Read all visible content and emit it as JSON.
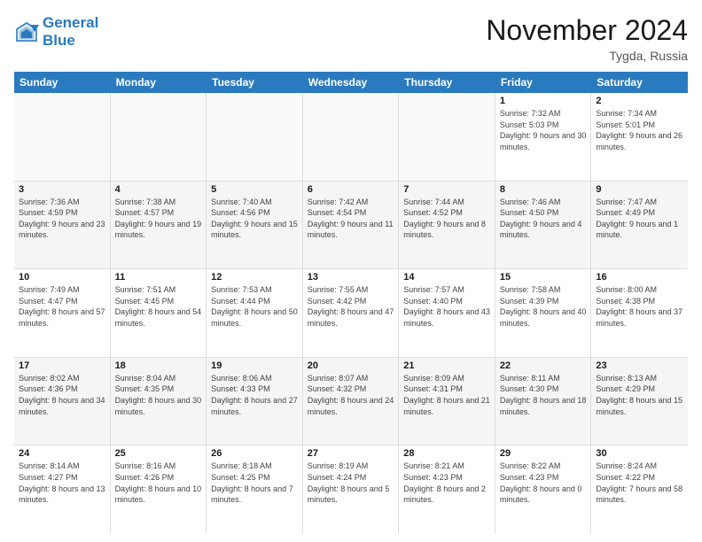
{
  "logo": {
    "line1": "General",
    "line2": "Blue"
  },
  "title": "November 2024",
  "location": "Tygda, Russia",
  "header_days": [
    "Sunday",
    "Monday",
    "Tuesday",
    "Wednesday",
    "Thursday",
    "Friday",
    "Saturday"
  ],
  "weeks": [
    [
      {
        "day": "",
        "info": "",
        "empty": true
      },
      {
        "day": "",
        "info": "",
        "empty": true
      },
      {
        "day": "",
        "info": "",
        "empty": true
      },
      {
        "day": "",
        "info": "",
        "empty": true
      },
      {
        "day": "",
        "info": "",
        "empty": true
      },
      {
        "day": "1",
        "info": "Sunrise: 7:32 AM\nSunset: 5:03 PM\nDaylight: 9 hours and 30 minutes.",
        "empty": false
      },
      {
        "day": "2",
        "info": "Sunrise: 7:34 AM\nSunset: 5:01 PM\nDaylight: 9 hours and 26 minutes.",
        "empty": false
      }
    ],
    [
      {
        "day": "3",
        "info": "Sunrise: 7:36 AM\nSunset: 4:59 PM\nDaylight: 9 hours and 23 minutes.",
        "empty": false
      },
      {
        "day": "4",
        "info": "Sunrise: 7:38 AM\nSunset: 4:57 PM\nDaylight: 9 hours and 19 minutes.",
        "empty": false
      },
      {
        "day": "5",
        "info": "Sunrise: 7:40 AM\nSunset: 4:56 PM\nDaylight: 9 hours and 15 minutes.",
        "empty": false
      },
      {
        "day": "6",
        "info": "Sunrise: 7:42 AM\nSunset: 4:54 PM\nDaylight: 9 hours and 11 minutes.",
        "empty": false
      },
      {
        "day": "7",
        "info": "Sunrise: 7:44 AM\nSunset: 4:52 PM\nDaylight: 9 hours and 8 minutes.",
        "empty": false
      },
      {
        "day": "8",
        "info": "Sunrise: 7:46 AM\nSunset: 4:50 PM\nDaylight: 9 hours and 4 minutes.",
        "empty": false
      },
      {
        "day": "9",
        "info": "Sunrise: 7:47 AM\nSunset: 4:49 PM\nDaylight: 9 hours and 1 minute.",
        "empty": false
      }
    ],
    [
      {
        "day": "10",
        "info": "Sunrise: 7:49 AM\nSunset: 4:47 PM\nDaylight: 8 hours and 57 minutes.",
        "empty": false
      },
      {
        "day": "11",
        "info": "Sunrise: 7:51 AM\nSunset: 4:45 PM\nDaylight: 8 hours and 54 minutes.",
        "empty": false
      },
      {
        "day": "12",
        "info": "Sunrise: 7:53 AM\nSunset: 4:44 PM\nDaylight: 8 hours and 50 minutes.",
        "empty": false
      },
      {
        "day": "13",
        "info": "Sunrise: 7:55 AM\nSunset: 4:42 PM\nDaylight: 8 hours and 47 minutes.",
        "empty": false
      },
      {
        "day": "14",
        "info": "Sunrise: 7:57 AM\nSunset: 4:40 PM\nDaylight: 8 hours and 43 minutes.",
        "empty": false
      },
      {
        "day": "15",
        "info": "Sunrise: 7:58 AM\nSunset: 4:39 PM\nDaylight: 8 hours and 40 minutes.",
        "empty": false
      },
      {
        "day": "16",
        "info": "Sunrise: 8:00 AM\nSunset: 4:38 PM\nDaylight: 8 hours and 37 minutes.",
        "empty": false
      }
    ],
    [
      {
        "day": "17",
        "info": "Sunrise: 8:02 AM\nSunset: 4:36 PM\nDaylight: 8 hours and 34 minutes.",
        "empty": false
      },
      {
        "day": "18",
        "info": "Sunrise: 8:04 AM\nSunset: 4:35 PM\nDaylight: 8 hours and 30 minutes.",
        "empty": false
      },
      {
        "day": "19",
        "info": "Sunrise: 8:06 AM\nSunset: 4:33 PM\nDaylight: 8 hours and 27 minutes.",
        "empty": false
      },
      {
        "day": "20",
        "info": "Sunrise: 8:07 AM\nSunset: 4:32 PM\nDaylight: 8 hours and 24 minutes.",
        "empty": false
      },
      {
        "day": "21",
        "info": "Sunrise: 8:09 AM\nSunset: 4:31 PM\nDaylight: 8 hours and 21 minutes.",
        "empty": false
      },
      {
        "day": "22",
        "info": "Sunrise: 8:11 AM\nSunset: 4:30 PM\nDaylight: 8 hours and 18 minutes.",
        "empty": false
      },
      {
        "day": "23",
        "info": "Sunrise: 8:13 AM\nSunset: 4:29 PM\nDaylight: 8 hours and 15 minutes.",
        "empty": false
      }
    ],
    [
      {
        "day": "24",
        "info": "Sunrise: 8:14 AM\nSunset: 4:27 PM\nDaylight: 8 hours and 13 minutes.",
        "empty": false
      },
      {
        "day": "25",
        "info": "Sunrise: 8:16 AM\nSunset: 4:26 PM\nDaylight: 8 hours and 10 minutes.",
        "empty": false
      },
      {
        "day": "26",
        "info": "Sunrise: 8:18 AM\nSunset: 4:25 PM\nDaylight: 8 hours and 7 minutes.",
        "empty": false
      },
      {
        "day": "27",
        "info": "Sunrise: 8:19 AM\nSunset: 4:24 PM\nDaylight: 8 hours and 5 minutes.",
        "empty": false
      },
      {
        "day": "28",
        "info": "Sunrise: 8:21 AM\nSunset: 4:23 PM\nDaylight: 8 hours and 2 minutes.",
        "empty": false
      },
      {
        "day": "29",
        "info": "Sunrise: 8:22 AM\nSunset: 4:23 PM\nDaylight: 8 hours and 0 minutes.",
        "empty": false
      },
      {
        "day": "30",
        "info": "Sunrise: 8:24 AM\nSunset: 4:22 PM\nDaylight: 7 hours and 58 minutes.",
        "empty": false
      }
    ]
  ]
}
